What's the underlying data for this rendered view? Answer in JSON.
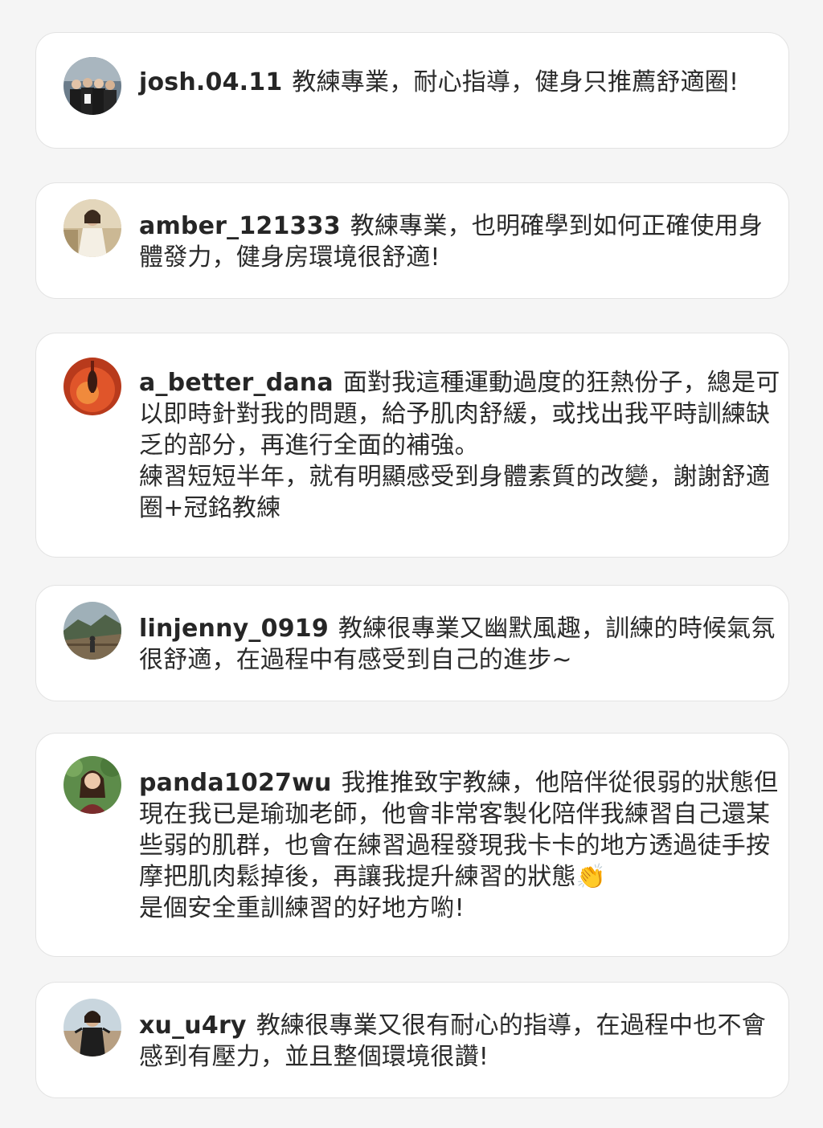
{
  "comments": [
    {
      "username": "josh.04.11",
      "text": "教練專業，耐心指導，健身只推薦舒適圈!"
    },
    {
      "username": "amber_121333",
      "text": "教練專業，也明確學到如何正確使用身體發力，健身房環境很舒適!"
    },
    {
      "username": "a_better_dana",
      "text": "面對我這種運動過度的狂熱份子，總是可以即時針對我的問題，給予肌肉舒緩，或找出我平時訓練缺乏的部分，再進行全面的補強。",
      "text2": "練習短短半年，就有明顯感受到身體素質的改變，謝謝舒適圈+冠銘教練"
    },
    {
      "username": "linjenny_0919",
      "text": "教練很專業又幽默風趣，訓練的時候氣氛很舒適，在過程中有感受到自己的進步~"
    },
    {
      "username": "panda1027wu",
      "text": "我推推致宇教練，他陪伴從很弱的狀態但現在我已是瑜珈老師，他會非常客製化陪伴我練習自己還某些弱的肌群，也會在練習過程發現我卡卡的地方透過徒手按摩把肌肉鬆掉後，再讓我提升練習的狀態👏",
      "text2": "是個安全重訓練習的好地方喲!"
    },
    {
      "username": "xu_u4ry",
      "text": "教練很專業又很有耐心的指導，在過程中也不會感到有壓力，並且整個環境很讚!"
    }
  ]
}
